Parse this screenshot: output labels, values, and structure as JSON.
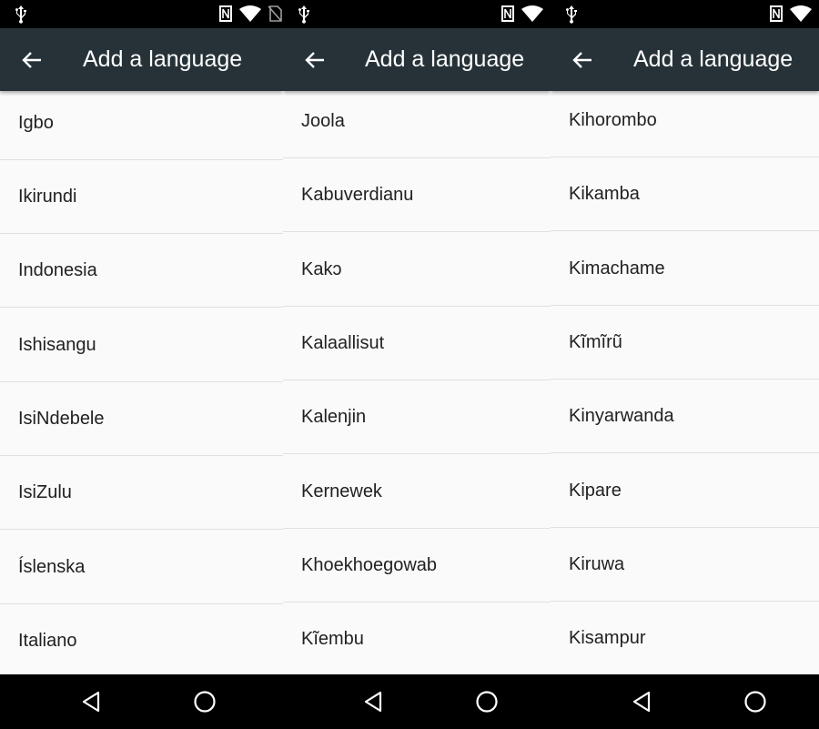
{
  "screens": [
    {
      "title": "Add a language",
      "items": [
        "Igbo",
        "Ikirundi",
        "Indonesia",
        "Ishisangu",
        "IsiNdebele",
        "IsiZulu",
        "Íslenska",
        "Italiano"
      ]
    },
    {
      "title": "Add a language",
      "items": [
        "Joola",
        "Kabuverdianu",
        "Kakɔ",
        "Kalaallisut",
        "Kalenjin",
        "Kernewek",
        "Khoekhoegowab",
        "Kĩembu"
      ]
    },
    {
      "title": "Add a language",
      "items": [
        "Kihorombo",
        "Kikamba",
        "Kimachame",
        "Kĩmĩrũ",
        "Kinyarwanda",
        "Kipare",
        "Kiruwa",
        "Kisampur"
      ]
    }
  ],
  "icons": {
    "status": [
      "usb-icon",
      "nfc-icon",
      "wifi-icon",
      "no-sim-icon"
    ],
    "nav": [
      "back-triangle-icon",
      "home-circle-icon"
    ],
    "app_bar": [
      "arrow-back-icon"
    ]
  },
  "colors": {
    "app_bar": "#263238",
    "list_background": "#fafafa",
    "divider": "#e0e0e0",
    "text": "#212121"
  }
}
